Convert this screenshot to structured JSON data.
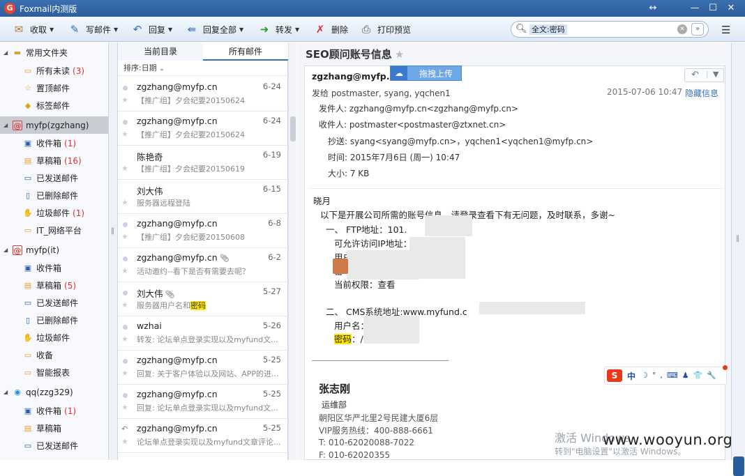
{
  "window": {
    "title": "Foxmail内测版",
    "logo_glyph": "G",
    "min": "—",
    "max": "☐",
    "close": "✕",
    "resize": "↔"
  },
  "toolbar": {
    "receive": "收取",
    "compose": "写邮件",
    "reply": "回复",
    "reply_all": "回复全部",
    "forward": "转发",
    "delete": "删除",
    "print_preview": "打印预览",
    "search_tag": "全文:密码",
    "clear": "✕",
    "expand": "»",
    "menu": "☰"
  },
  "sidebar": {
    "groups": [
      {
        "label": "常用文件夹",
        "icon": "folder-icon",
        "items": [
          {
            "label": "所有未读",
            "count": "(3)"
          },
          {
            "label": "置顶邮件",
            "count": ""
          },
          {
            "label": "标签邮件",
            "count": ""
          }
        ]
      },
      {
        "label": "myfp(zgzhang)",
        "icon": "account-icon",
        "items": [
          {
            "label": "收件箱",
            "count": "(1)"
          },
          {
            "label": "草稿箱",
            "count": "(16)"
          },
          {
            "label": "已发送邮件",
            "count": ""
          },
          {
            "label": "已删除邮件",
            "count": ""
          },
          {
            "label": "垃圾邮件",
            "count": "(1)"
          },
          {
            "label": "IT_网络平台",
            "count": ""
          }
        ]
      },
      {
        "label": "myfp(it)",
        "icon": "account-icon",
        "items": [
          {
            "label": "收件箱",
            "count": ""
          },
          {
            "label": "草稿箱",
            "count": "(5)"
          },
          {
            "label": "已发送邮件",
            "count": ""
          },
          {
            "label": "已删除邮件",
            "count": ""
          },
          {
            "label": "垃圾邮件",
            "count": ""
          },
          {
            "label": "收备",
            "count": ""
          },
          {
            "label": "智能报表",
            "count": ""
          }
        ]
      },
      {
        "label": "qq(zzg329)",
        "icon": "qq-icon",
        "items": [
          {
            "label": "收件箱",
            "count": "(1)"
          },
          {
            "label": "草稿箱",
            "count": ""
          },
          {
            "label": "已发送邮件",
            "count": ""
          }
        ]
      }
    ]
  },
  "list": {
    "tabs": [
      "当前目录",
      "所有邮件"
    ],
    "sort": "排序:日期",
    "mails": [
      {
        "from": "zgzhang@myfp.cn",
        "date": "6-24",
        "subject": "【推广组】夕会纪要20150624"
      },
      {
        "from": "zgzhang@myfp.cn",
        "date": "6-24",
        "subject": "【推广组】夕会纪要20150624"
      },
      {
        "from": "陈艳奇",
        "date": "6-19",
        "subject": "【推广组】夕会纪要20150619"
      },
      {
        "from": "刘大伟",
        "date": "6-15",
        "subject": "服务器远程登陆"
      },
      {
        "from": "zgzhang@myfp.cn",
        "date": "6-8",
        "subject": "【推广组】夕会纪要20150608"
      },
      {
        "from": "zgzhang@myfp.cn",
        "date": "6-2",
        "subject": "活动邀约--看下是否有需要去呢？"
      },
      {
        "from": "刘大伟",
        "date": "5-27",
        "subject_pre": "服务器用户名和",
        "subject_hl": "密码"
      },
      {
        "from": "wzhai",
        "date": "5-26",
        "subject": "转发: 论坛单点登录实现以及myfund文..."
      },
      {
        "from": "zgzhang@myfp.cn",
        "date": "5-25",
        "subject": "回复: 关于客户体验以及网站、APP的进..."
      },
      {
        "from": "zgzhang@myfp.cn",
        "date": "5-25",
        "subject": "回复: 论坛单点登录实现以及myfund文..."
      },
      {
        "from": "zgzhang@myfp.cn",
        "date": "5-25",
        "subject": "论坛单点登录实现以及myfund文章评论..."
      }
    ]
  },
  "reader": {
    "subject": "SEO顾问账号信息",
    "star": "★",
    "sender": "zgzhang@myfp.cn",
    "upload": "拖拽上传",
    "sent_to": "发给 postmaster, syang, yqchen1",
    "time": "2015-07-06 10:47",
    "hide": "隐藏信息",
    "headers": {
      "from": "发件人: zgzhang@myfp.cn<zgzhang@myfp.cn>",
      "to": "收件人: postmaster<postmaster@ztxnet.cn>",
      "cc": "抄送: syang<syang@myfp.cn>，yqchen1<yqchen1@myfp.cn>",
      "date": "时间: 2015年7月6日 (周一) 10:47",
      "size": "大小: 7 KB"
    },
    "body": {
      "greeting": "晓月",
      "intro": "以下是开展公司所需的账号信息，请登录查看下有无问题，及时联系，多谢~",
      "s1_title": "一、   FTP地址：101.",
      "s1_ip": "可允许访问IP地址：",
      "s1_user": "用户名：",
      "s1_pwd": "密",
      "s1_perm": "当前权限：查看",
      "s2_title": "二、  CMS系统地址:www.myfund.c",
      "s2_user": "用户名：",
      "s2_pwd": "密码",
      "s2_pwd_after": "：/"
    },
    "signature": {
      "name": "张志刚",
      "dept": "运维部",
      "addr": "朝阳区华严北里2号民建大厦6层",
      "hotline": "VIP服务热线：400-888-6661",
      "tel": "T:   010-62020088-7022",
      "fax": "F:   010-62020355"
    }
  },
  "ime": {
    "s": "S",
    "zh": "中",
    "rest": "☽°,⌨♟👕🔧"
  },
  "watermark": {
    "line1": "激活 Windows",
    "line2": "转到\"电脑设置\"以激活 Windows。",
    "site": "www.wooyun.org"
  }
}
